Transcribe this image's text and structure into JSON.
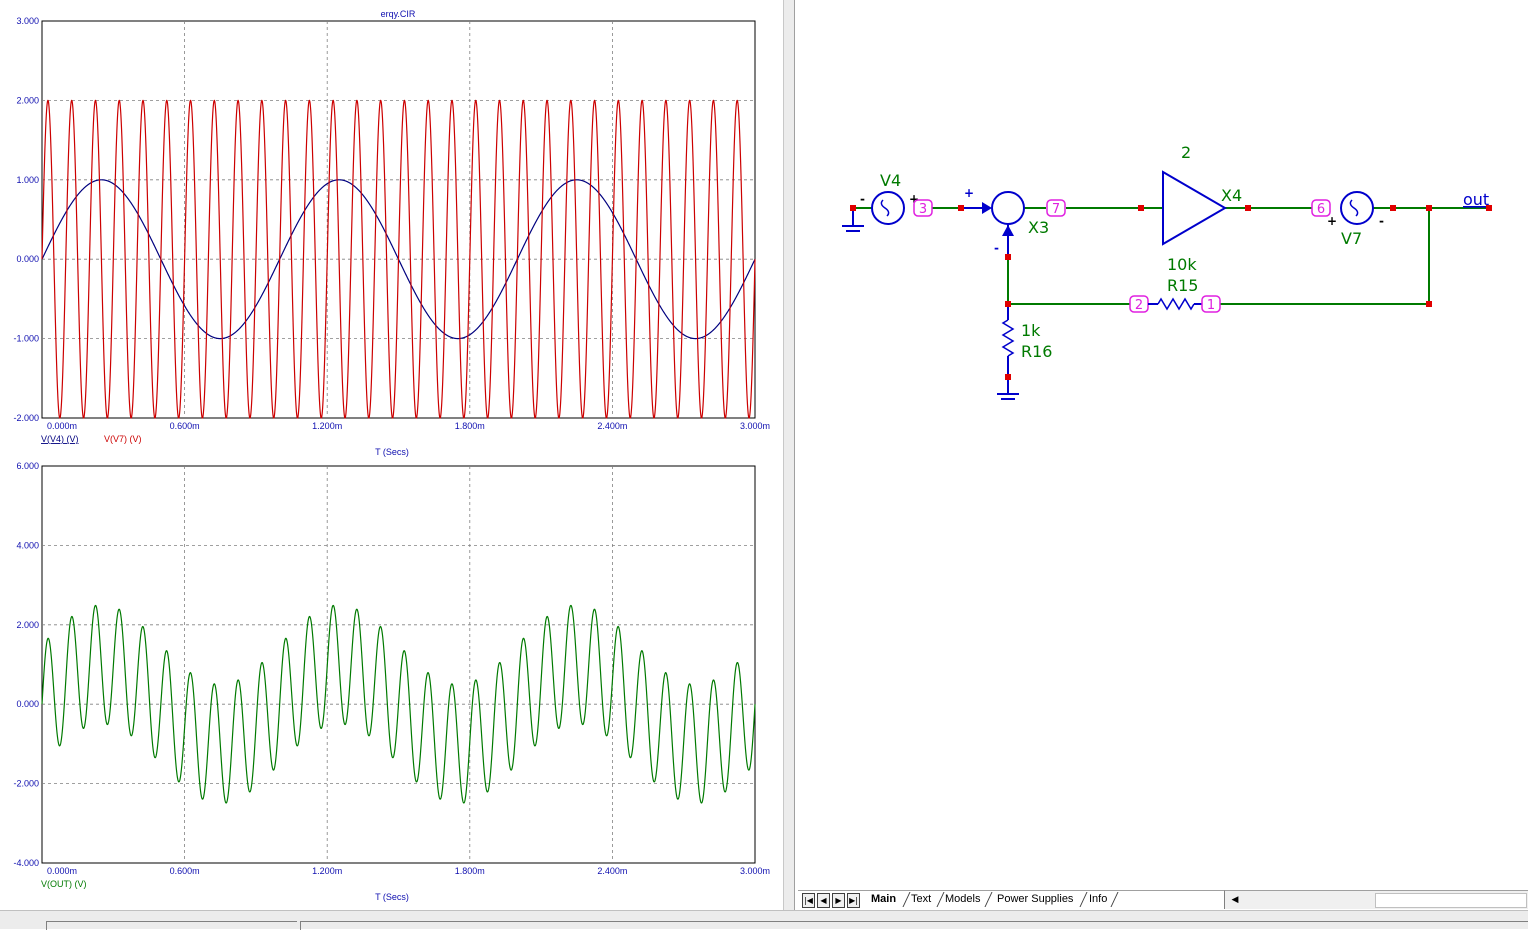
{
  "plot_window": {
    "title": "erqy.CIR",
    "x_axis_label": "T (Secs)"
  },
  "chart_data": [
    {
      "type": "line",
      "title": "erqy.CIR",
      "xlabel": "T (Secs)",
      "x_tick_labels": [
        "0.000m",
        "0.600m",
        "1.200m",
        "1.800m",
        "2.400m",
        "3.000m"
      ],
      "y_tick_labels": [
        "3.000",
        "2.000",
        "1.000",
        "0.000",
        "-1.000",
        "-2.000"
      ],
      "xlim": [
        0,
        3.0
      ],
      "ylim": [
        -2,
        3
      ],
      "x_unit": "ms",
      "grid": true,
      "series": [
        {
          "name": "V(V4) (V)",
          "color": "#00007f",
          "waveform": "sine",
          "amplitude": 1.0,
          "frequency_hz": 1000,
          "phase_deg": 0,
          "offset": 0
        },
        {
          "name": "V(V7) (V)",
          "color": "#cc0000",
          "waveform": "sine",
          "amplitude": 2.0,
          "frequency_hz": 10000,
          "phase_deg": 0,
          "offset": 0
        }
      ]
    },
    {
      "type": "line",
      "xlabel": "T (Secs)",
      "x_tick_labels": [
        "0.000m",
        "0.600m",
        "1.200m",
        "1.800m",
        "2.400m",
        "3.000m"
      ],
      "y_tick_labels": [
        "6.000",
        "4.000",
        "2.000",
        "0.000",
        "-2.000",
        "-4.000"
      ],
      "xlim": [
        0,
        3.0
      ],
      "ylim": [
        -4,
        6
      ],
      "x_unit": "ms",
      "grid": true,
      "series": [
        {
          "name": "V(OUT) (V)",
          "color": "#007a00",
          "waveform": "V(V4) + 0.5*V(V7)",
          "x_start": 0,
          "x_end": 3.0
        }
      ]
    }
  ],
  "schematic": {
    "components": {
      "v4": {
        "name": "V4",
        "plus": "+",
        "minus": "-"
      },
      "v7": {
        "name": "V7",
        "plus": "+",
        "minus": "-"
      },
      "x3": {
        "name": "X3",
        "plus": "+",
        "minus": "-"
      },
      "x4": {
        "name": "X4",
        "gain": "2"
      },
      "r15": {
        "name": "R15",
        "value": "10k"
      },
      "r16": {
        "name": "R16",
        "value": "1k"
      }
    },
    "nodes": {
      "n3": "3",
      "n7": "7",
      "n6": "6",
      "n2": "2",
      "n1": "1"
    },
    "out_label": "out"
  },
  "tabs": [
    {
      "label": "Main",
      "active": true
    },
    {
      "label": "Text",
      "active": false
    },
    {
      "label": "Models",
      "active": false
    },
    {
      "label": "Power Supplies",
      "active": false
    },
    {
      "label": "Info",
      "active": false
    }
  ],
  "colors": {
    "grid": "#808080",
    "tick_text": "#1010b0",
    "wire": "#007a00",
    "component": "#0000cc",
    "node_dot": "#e00000",
    "pin_label": "#e020e0"
  }
}
